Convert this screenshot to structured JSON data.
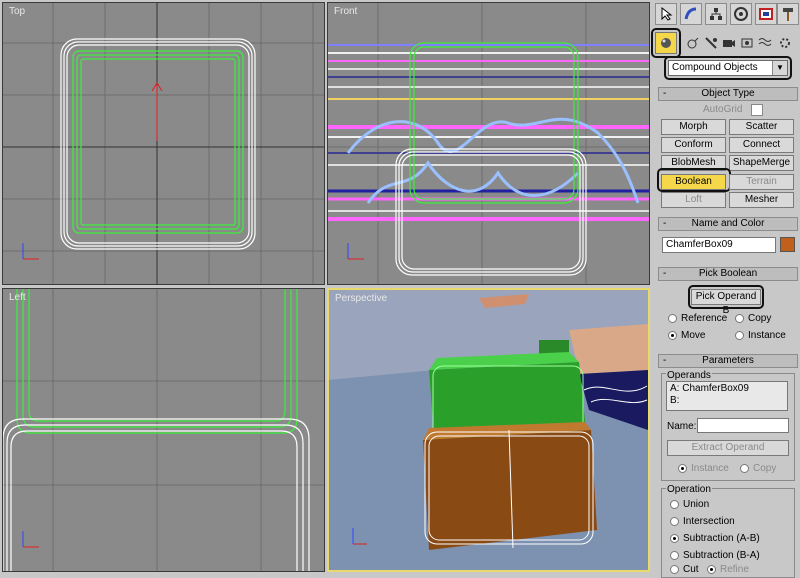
{
  "viewports": {
    "top": {
      "label": "Top"
    },
    "front": {
      "label": "Front"
    },
    "left": {
      "label": "Left"
    },
    "perspective": {
      "label": "Perspective"
    }
  },
  "toolbar": {
    "main_icons": [
      "pointer-icon",
      "curve-icon",
      "hierarchy-icon",
      "motion-icon",
      "display-icon",
      "utilities-icon"
    ],
    "sub_icons": [
      "geometry-icon",
      "shapes-icon",
      "lights-icon",
      "cameras-icon",
      "helpers-icon",
      "spacewarps-icon",
      "systems-icon"
    ],
    "category_value": "Compound Objects"
  },
  "object_type": {
    "title": "Object Type",
    "autogrid_label": "AutoGrid",
    "buttons": [
      {
        "label": "Morph",
        "enabled": true
      },
      {
        "label": "Scatter",
        "enabled": true
      },
      {
        "label": "Conform",
        "enabled": true
      },
      {
        "label": "Connect",
        "enabled": true
      },
      {
        "label": "BlobMesh",
        "enabled": true
      },
      {
        "label": "ShapeMerge",
        "enabled": true
      },
      {
        "label": "Boolean",
        "enabled": true,
        "active": true
      },
      {
        "label": "Terrain",
        "enabled": false
      },
      {
        "label": "Loft",
        "enabled": false
      },
      {
        "label": "Mesher",
        "enabled": true
      }
    ]
  },
  "name_color": {
    "title": "Name and Color",
    "name_value": "ChamferBox09",
    "swatch_color": "#c0601a"
  },
  "pick_boolean": {
    "title": "Pick Boolean",
    "button_label": "Pick Operand B",
    "reference_label": "Reference",
    "copy_label": "Copy",
    "move_label": "Move",
    "instance_label": "Instance"
  },
  "parameters": {
    "title": "Parameters",
    "operands_group": "Operands",
    "operand_a": "A: ChamferBox09",
    "operand_b": "B:",
    "name_label": "Name:",
    "extract_label": "Extract Operand",
    "instance_label": "Instance",
    "copy_label": "Copy",
    "operation_group": "Operation",
    "operations": [
      "Union",
      "Intersection",
      "Subtraction (A-B)",
      "Subtraction (B-A)",
      "Cut"
    ],
    "refine_label": "Refine",
    "selected_operation": "Subtraction (A-B)"
  },
  "colors": {
    "viewport_bg": "#8a8a8a",
    "selection_green": "#3cf03c",
    "wire_white": "#ffffff",
    "highlight_yellow": "#f5d84a",
    "active_border": "#e9d86a"
  }
}
